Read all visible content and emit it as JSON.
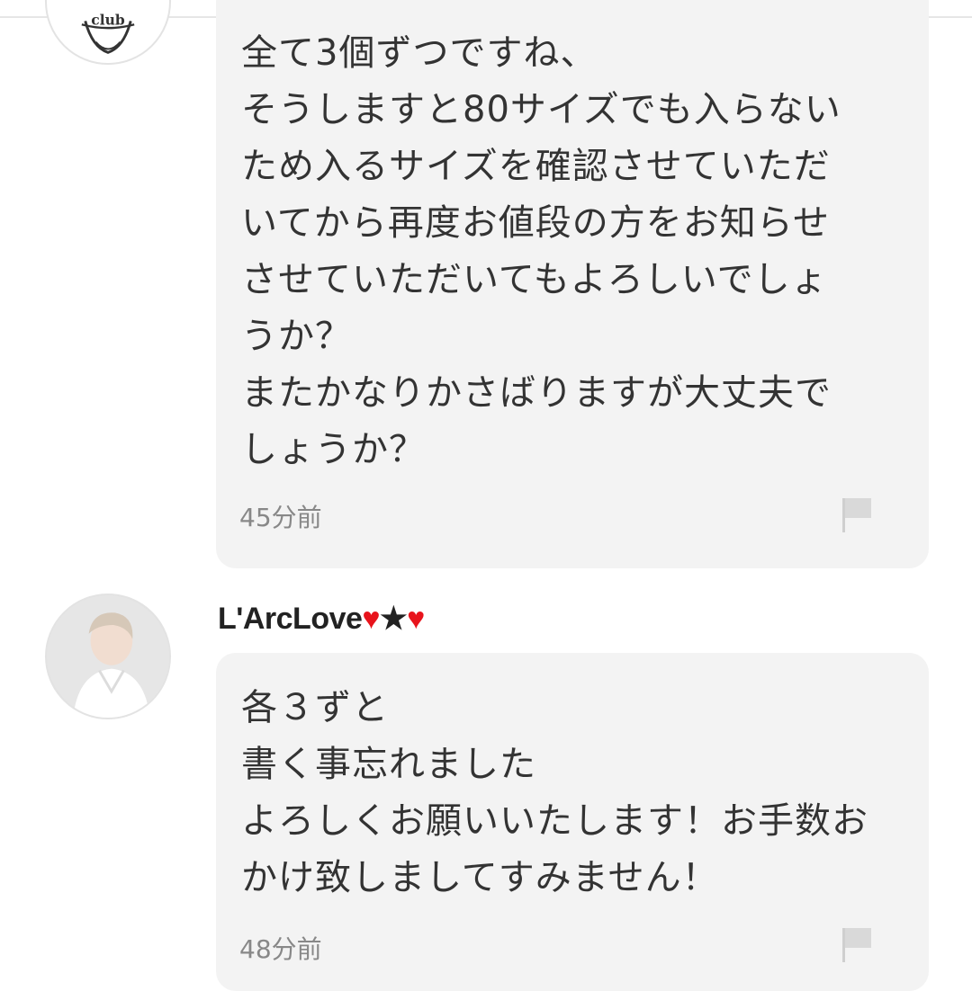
{
  "comments": [
    {
      "avatar": {
        "icon": "user-avatar-club-icon",
        "text": "club"
      },
      "lines": [
        "全て3個ずつですね、",
        "そうしますと80サイズでも入らない",
        "ため入るサイズを確認させていただ",
        "いてから再度お値段の方をお知らせ",
        "させていただいてもよろしいでしょ",
        "うか？",
        "またかなりかさばりますが大丈夫で",
        "しょうか？"
      ],
      "timestamp": "45分前",
      "flag_icon": "report-flag-icon"
    },
    {
      "avatar": {
        "icon": "user-avatar-photo-icon"
      },
      "username": {
        "name": "L'ArcLove",
        "heart1": "♥",
        "star": "★",
        "heart2": "♥"
      },
      "lines": [
        "各３ずと",
        "書く事忘れました",
        "よろしくお願いいたします！お手数お",
        "かけ致しましてすみません！"
      ],
      "timestamp": "48分前",
      "flag_icon": "report-flag-icon"
    }
  ],
  "colors": {
    "bubble": "#f3f3f3",
    "heart": "#e8141c",
    "timestamp": "#888888"
  }
}
